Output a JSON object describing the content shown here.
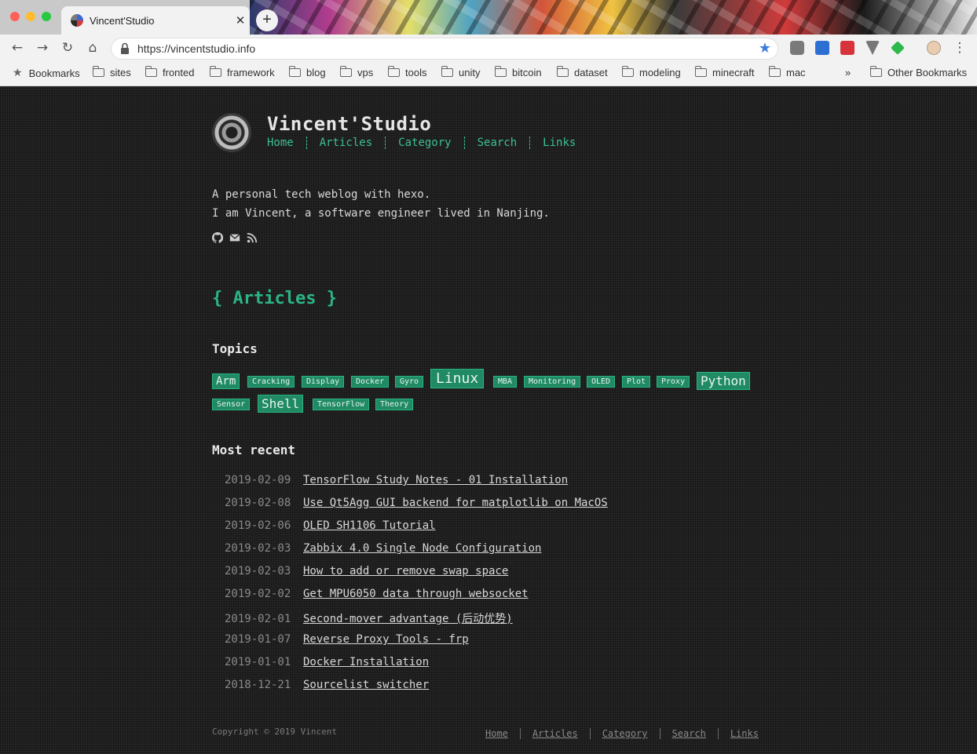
{
  "browser": {
    "tab_title": "Vincent'Studio",
    "tab_close": "✕",
    "new_tab": "+",
    "url": "https://vincentstudio.info",
    "bookmarks": [
      "Bookmarks",
      "sites",
      "fronted",
      "framework",
      "blog",
      "vps",
      "tools",
      "unity",
      "bitcoin",
      "dataset",
      "modeling",
      "minecraft",
      "mac"
    ],
    "overflow": "»",
    "other_bookmarks": "Other Bookmarks",
    "accent_color": "#3b7ddc"
  },
  "site": {
    "title": "Vincent'Studio",
    "nav": [
      "Home",
      "Articles",
      "Category",
      "Search",
      "Links"
    ],
    "intro": [
      "A personal tech weblog with hexo.",
      "I am Vincent, a software engineer lived in Nanjing."
    ],
    "social_icons": [
      "github-icon",
      "mail-icon",
      "rss-icon"
    ],
    "accent_color": "#2ab585"
  },
  "main": {
    "heading": "{ Articles }",
    "topics_heading": "Topics",
    "tags": [
      "Arm",
      "Cracking",
      "Display",
      "Docker",
      "Gyro",
      "Linux",
      "MBA",
      "Monitoring",
      "OLED",
      "Plot",
      "Proxy",
      "Python",
      "Sensor",
      "Shell",
      "TensorFlow",
      "Theory"
    ],
    "recent_heading": "Most recent",
    "posts": [
      {
        "date": "2019-02-09",
        "title": "TensorFlow Study Notes - 01 Installation"
      },
      {
        "date": "2019-02-08",
        "title": "Use Qt5Agg GUI backend for matplotlib on MacOS"
      },
      {
        "date": "2019-02-06",
        "title": "OLED SH1106 Tutorial"
      },
      {
        "date": "2019-02-03",
        "title": "Zabbix 4.0 Single Node Configuration"
      },
      {
        "date": "2019-02-03",
        "title": "How to add or remove swap space"
      },
      {
        "date": "2019-02-02",
        "title": "Get MPU6050 data through websocket"
      },
      {
        "date": "2019-02-01",
        "title": "Second-mover advantage (后动优势)"
      },
      {
        "date": "2019-01-07",
        "title": "Reverse Proxy Tools - frp"
      },
      {
        "date": "2019-01-01",
        "title": "Docker Installation"
      },
      {
        "date": "2018-12-21",
        "title": "Sourcelist switcher"
      }
    ]
  },
  "footer": {
    "copyright": "Copyright © 2019 Vincent",
    "nav": [
      "Home",
      "Articles",
      "Category",
      "Search",
      "Links"
    ]
  }
}
